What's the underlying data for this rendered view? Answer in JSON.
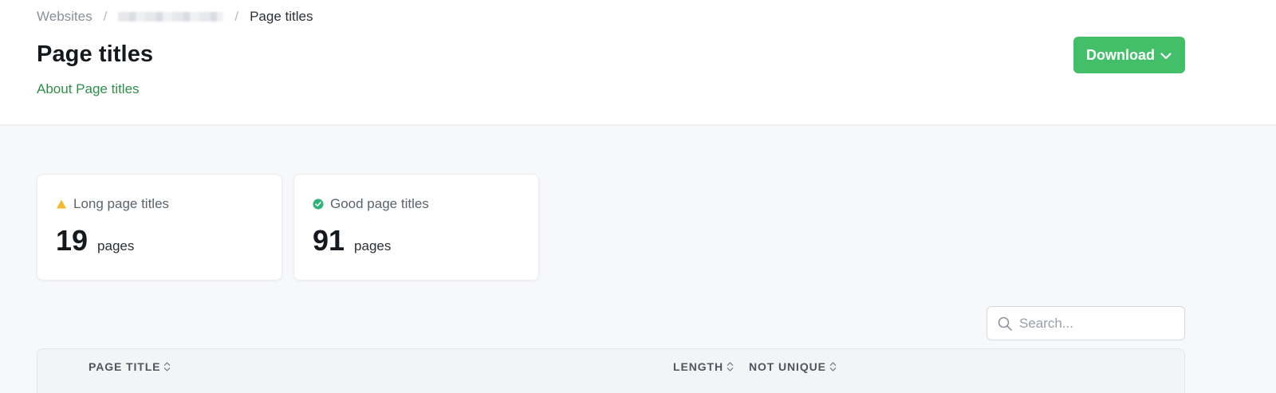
{
  "breadcrumb": {
    "root": "Websites",
    "separator": "/",
    "current": "Page titles"
  },
  "header": {
    "title": "Page titles",
    "about_link": "About Page titles",
    "download_label": "Download"
  },
  "cards": [
    {
      "icon": "warning-triangle-icon",
      "label": "Long page titles",
      "value": "19",
      "unit": "pages"
    },
    {
      "icon": "check-circle-icon",
      "label": "Good page titles",
      "value": "91",
      "unit": "pages"
    }
  ],
  "search": {
    "placeholder": "Search..."
  },
  "table": {
    "columns": [
      "PAGE TITLE",
      "LENGTH",
      "NOT UNIQUE"
    ]
  },
  "colors": {
    "accent_green": "#43bf6a",
    "link_green": "#2f8f49",
    "warning": "#f5b82e",
    "success": "#2fb379"
  }
}
